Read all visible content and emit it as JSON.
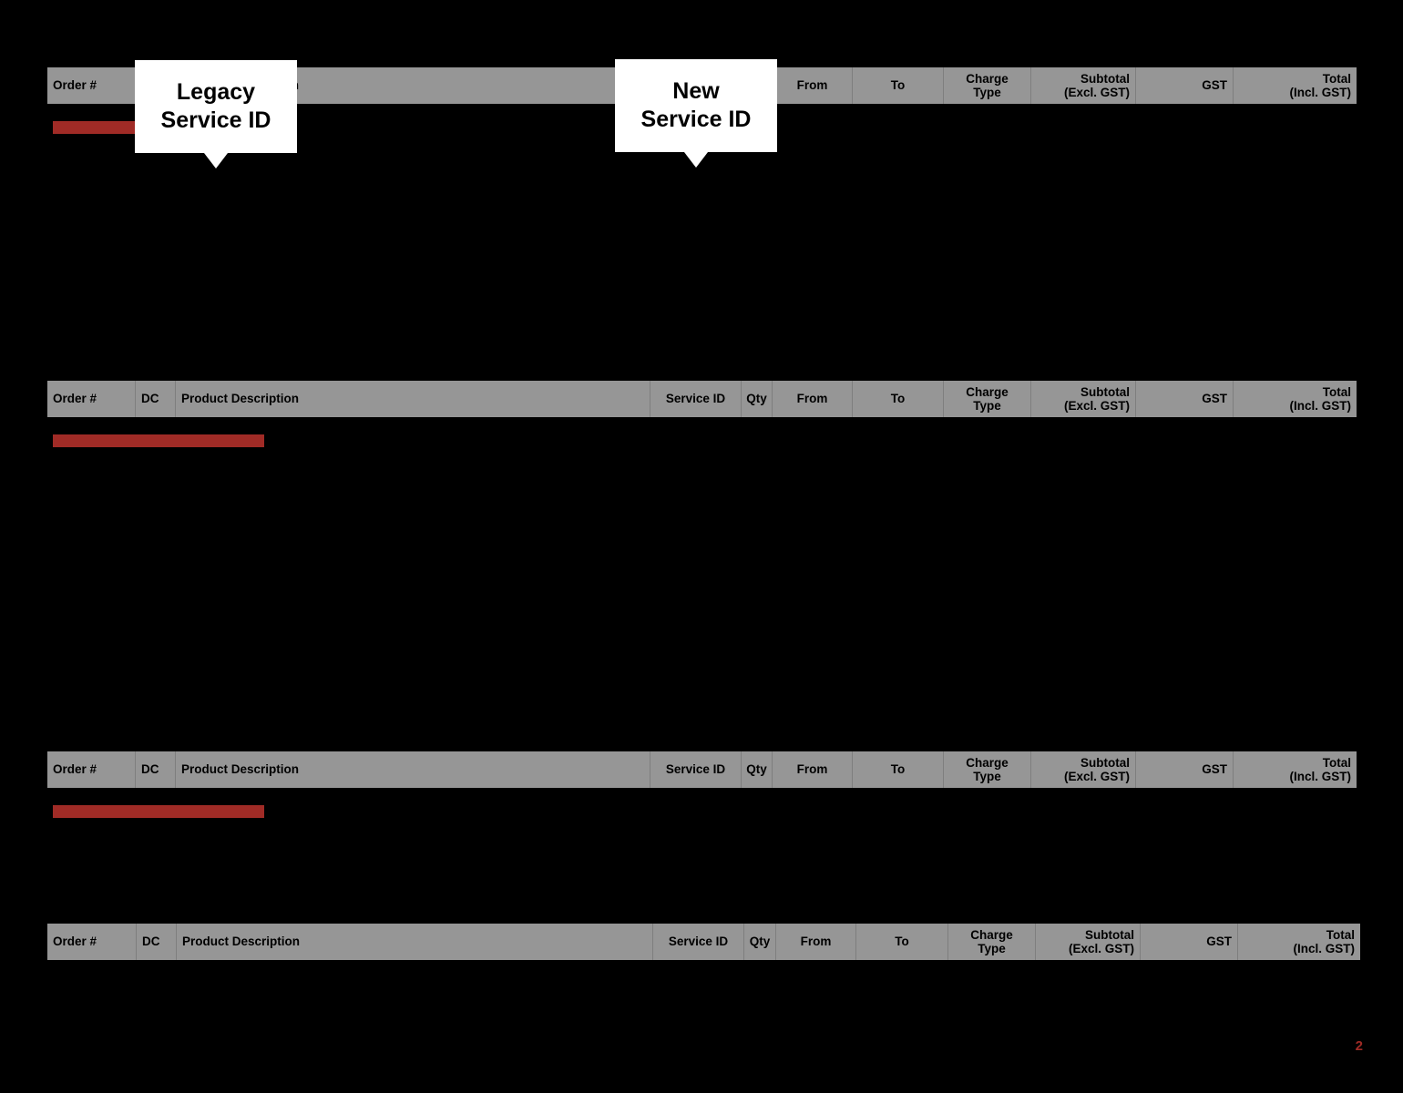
{
  "slide": {
    "background_color": "#000000",
    "page_number": "2"
  },
  "theme": {
    "header_fill": "#969696",
    "header_text": "#000000",
    "redaction_color": "#a02b26",
    "callout_fill": "#ffffff",
    "page_number_color": "#9f2a25"
  },
  "columns": {
    "order": "Order #",
    "dc": "DC",
    "product_description": "Product Description",
    "service_id": "Service ID",
    "qty": "Qty",
    "from": "From",
    "to": "To",
    "charge_type": "Charge\nType",
    "subtotal": "Subtotal\n(Excl. GST)",
    "gst": "GST",
    "total": "Total\n(Incl. GST)"
  },
  "tables": [
    {
      "id": "invoice-table-1",
      "headers": [
        "Order #",
        "DC",
        "Product Description",
        "Service ID",
        "Qty",
        "From",
        "To",
        "Charge\nType",
        "Subtotal\n(Excl. GST)",
        "GST",
        "Total\n(Incl. GST)"
      ],
      "rows": []
    },
    {
      "id": "invoice-table-2",
      "headers": [
        "Order #",
        "DC",
        "Product Description",
        "Service ID",
        "Qty",
        "From",
        "To",
        "Charge\nType",
        "Subtotal\n(Excl. GST)",
        "GST",
        "Total\n(Incl. GST)"
      ],
      "rows": []
    },
    {
      "id": "invoice-table-3",
      "headers": [
        "Order #",
        "DC",
        "Product Description",
        "Service ID",
        "Qty",
        "From",
        "To",
        "Charge\nType",
        "Subtotal\n(Excl. GST)",
        "GST",
        "Total\n(Incl. GST)"
      ],
      "rows": []
    },
    {
      "id": "invoice-table-4",
      "headers": [
        "Order #",
        "DC",
        "Product Description",
        "Service ID",
        "Qty",
        "From",
        "To",
        "Charge\nType",
        "Subtotal\n(Excl. GST)",
        "GST",
        "Total\n(Incl. GST)"
      ],
      "rows": []
    }
  ],
  "callouts": [
    {
      "id": "callout-legacy-service-id",
      "text": "Legacy\nService ID"
    },
    {
      "id": "callout-new-service-id",
      "text": "New\nService ID"
    }
  ],
  "redactions": [
    {
      "id": "redaction-bar-1"
    },
    {
      "id": "redaction-bar-2"
    },
    {
      "id": "redaction-bar-3"
    }
  ]
}
